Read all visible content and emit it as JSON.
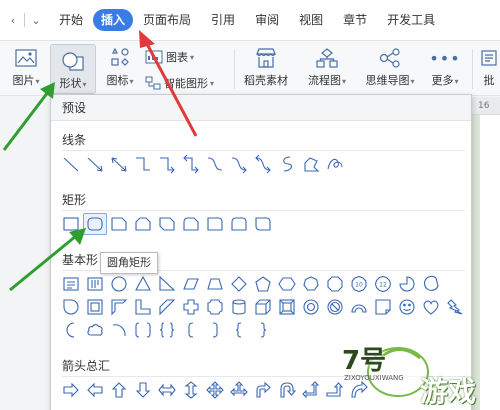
{
  "menubar": {
    "quick_access": [
      "‹",
      "⌄"
    ],
    "items": [
      "开始",
      "插入",
      "页面布局",
      "引用",
      "审阅",
      "视图",
      "章节",
      "开发工具"
    ],
    "active_index": 1
  },
  "toolbar": {
    "picture": "图片",
    "shape": "形状",
    "icon": "图标",
    "chart": "图表",
    "smart_shape": "智能图形",
    "stock_material": "稻壳素材",
    "flowchart": "流程图",
    "mindmap": "思维导图",
    "more": "更多",
    "batch": "批"
  },
  "ruler": {
    "number": "16"
  },
  "panel": {
    "header": "预设",
    "sections": {
      "lines": "线条",
      "rectangles": "矩形",
      "basic": "基本形状",
      "arrows": "箭头总汇"
    },
    "basic_visible_prefix": "基本形"
  },
  "tooltip": {
    "text": "圆角矩形"
  },
  "accent_colors": {
    "active_tab": "#3a7ce6",
    "green_arrow": "#2f9e2f",
    "red_arrow": "#e03a3a"
  },
  "watermark": {
    "text": "游戏",
    "sub": "ZIXOYOUXIWANG",
    "logo": "7号"
  }
}
